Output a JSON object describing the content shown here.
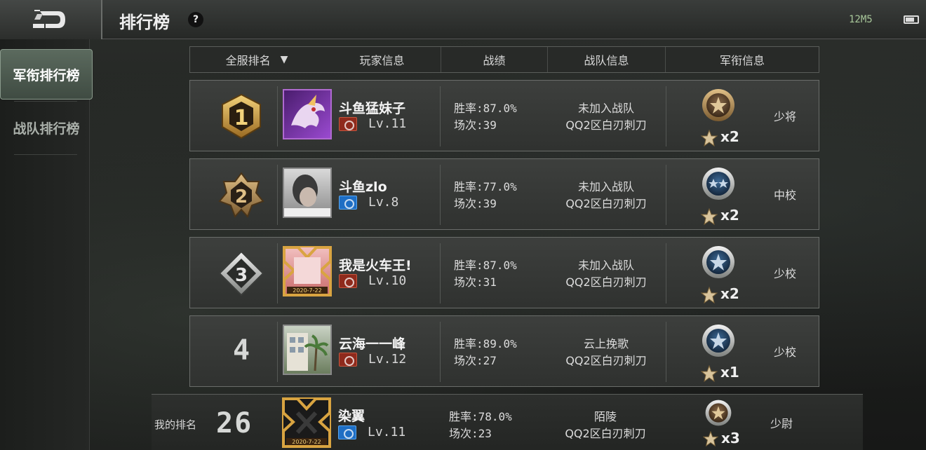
{
  "page": {
    "title": "排行榜",
    "help": "?"
  },
  "status": {
    "network": "12M5"
  },
  "sidebar": {
    "items": [
      {
        "label": "军衔排行榜"
      },
      {
        "label": "战队排行榜"
      }
    ]
  },
  "header": {
    "scope": "全服排名",
    "columns": [
      "玩家信息",
      "战绩",
      "战队信息",
      "军衔信息"
    ]
  },
  "rows": [
    {
      "rank": "1",
      "name": "斗鱼猛妹子",
      "level": "Lv.11",
      "win_rate": "胜率:87.0%",
      "matches": "场次:39",
      "team": "未加入战队",
      "server": "QQ2区白刃刺刀",
      "stars": "x2",
      "title": "少将"
    },
    {
      "rank": "2",
      "name": "斗鱼zlo",
      "level": "Lv.8",
      "win_rate": "胜率:77.0%",
      "matches": "场次:39",
      "team": "未加入战队",
      "server": "QQ2区白刃刺刀",
      "stars": "x2",
      "title": "中校"
    },
    {
      "rank": "3",
      "name": "我是火车王!",
      "level": "Lv.10",
      "win_rate": "胜率:87.0%",
      "matches": "场次:31",
      "team": "未加入战队",
      "server": "QQ2区白刃刺刀",
      "stars": "x2",
      "title": "少校"
    },
    {
      "rank": "4",
      "name": "云海一一峰",
      "level": "Lv.12",
      "win_rate": "胜率:89.0%",
      "matches": "场次:27",
      "team": "云上挽歌",
      "server": "QQ2区白刃刺刀",
      "stars": "x1",
      "title": "少校"
    }
  ],
  "my": {
    "label": "我的排名",
    "rank": "26",
    "name": "染翼",
    "level": "Lv.11",
    "win_rate": "胜率:78.0%",
    "matches": "场次:23",
    "team": "陌陵",
    "server": "QQ2区白刃刺刀",
    "stars": "x3",
    "title": "少尉",
    "avatar_date": "2020-7-22"
  },
  "avatar_dates": {
    "row3": "2020-7-22"
  },
  "colors": {
    "gold": "#d9a441",
    "silver": "#c8ccc8",
    "accent_green": "#5b6a5e"
  }
}
